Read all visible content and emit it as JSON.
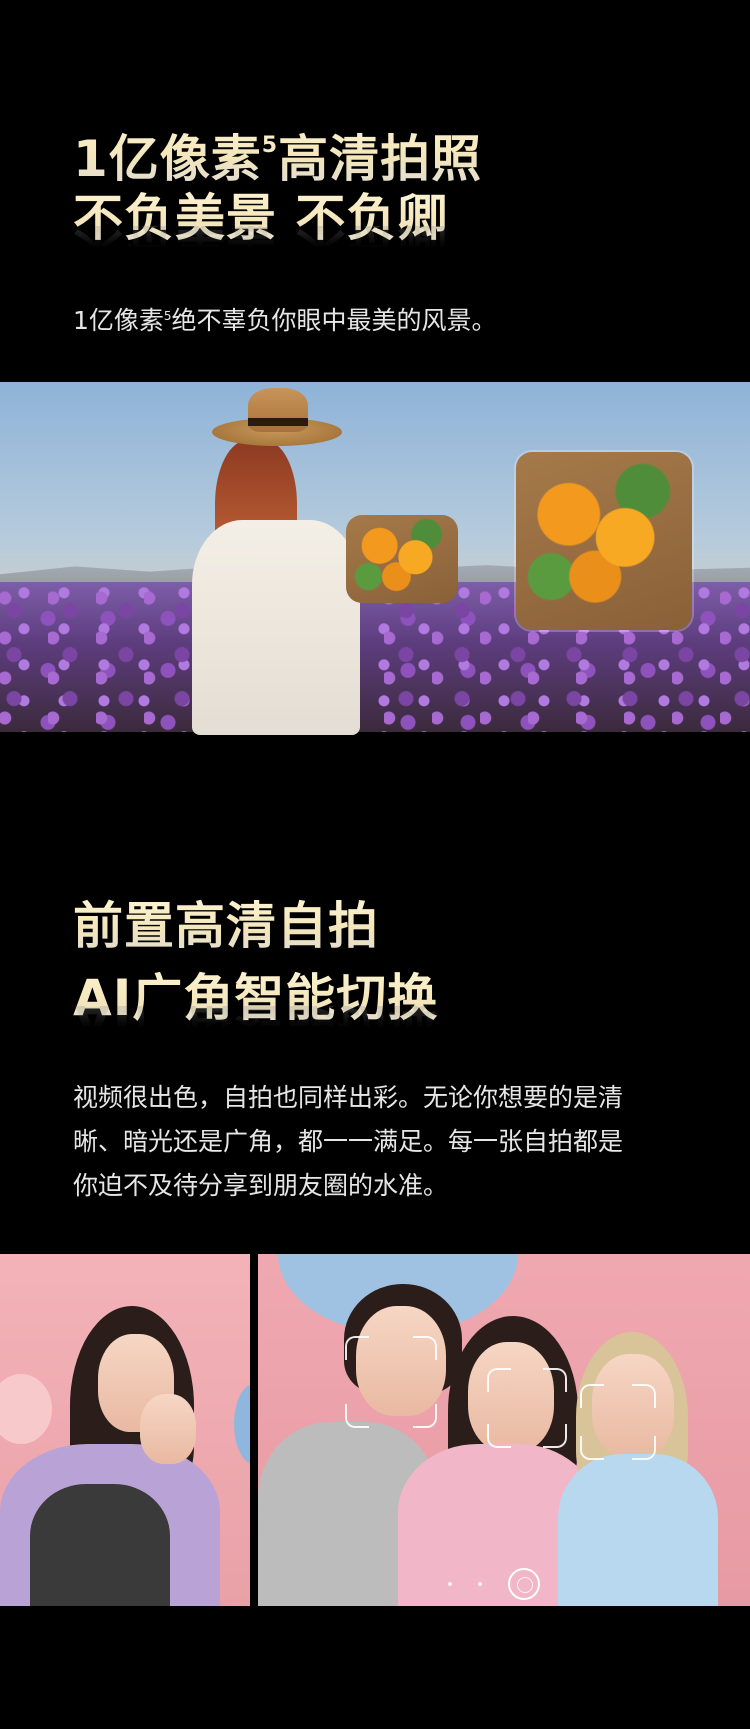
{
  "section1": {
    "headline_line1_main": "1亿像素",
    "headline_line1_sup": "5",
    "headline_line1_rest": "高清拍照",
    "headline_line2": "不负美景 不负卿",
    "body_main": "1亿像素",
    "body_sup": "5",
    "body_rest": "绝不辜负你眼中最美的风景。"
  },
  "section2": {
    "headline_line1": "前置高清自拍",
    "headline_line2": "AI广角智能切换",
    "body_line1": "视频很出色，自拍也同样出彩。无论你想要的是清",
    "body_line2": "晰、暗光还是广角，都一一满足。每一张自拍都是",
    "body_line3": "你迫不及待分享到朋友圈的水准。"
  },
  "images": {
    "photo1": "woman-in-flower-field-photo",
    "inset": "bouquet-zoom-inset",
    "selfie_single": "single-selfie-photo",
    "selfie_group": "group-selfie-photo"
  },
  "colors": {
    "background": "#000000",
    "headline_gold": "#f4e6bb",
    "body_text": "#e6e6e6"
  }
}
